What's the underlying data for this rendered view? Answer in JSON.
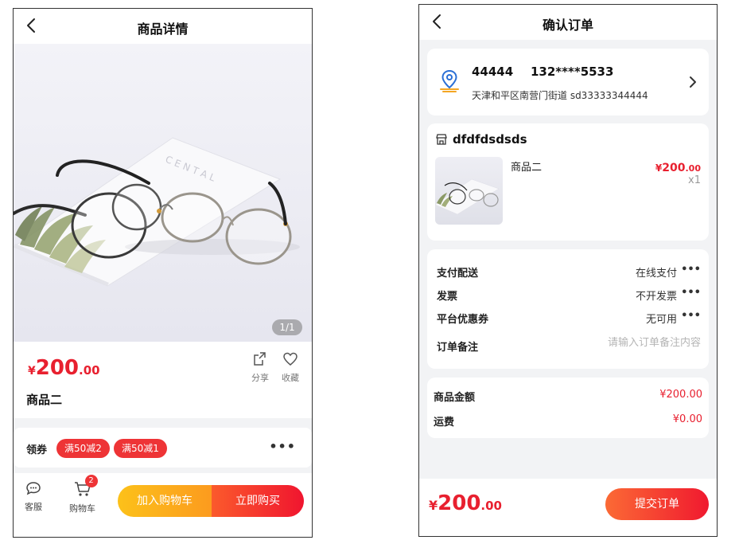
{
  "product_page": {
    "title": "商品详情",
    "image_counter": "1/1",
    "price": {
      "currency": "¥",
      "integer": "200",
      "decimal": ".00"
    },
    "product_name": "商品二",
    "share_label": "分享",
    "favorite_label": "收藏",
    "coupons": {
      "label": "领券",
      "tags": [
        "满50减2",
        "满50减1"
      ]
    },
    "bottom_bar": {
      "service_label": "客服",
      "cart_label": "购物车",
      "cart_badge": "2",
      "add_to_cart_label": "加入购物车",
      "buy_now_label": "立即购买"
    },
    "icons": {
      "back": "chevron-left-icon",
      "share": "share-icon",
      "favorite": "heart-icon",
      "service": "chat-icon",
      "cart": "cart-icon",
      "more": "more-dots-icon"
    }
  },
  "order_page": {
    "title": "确认订单",
    "address": {
      "name": "44444",
      "phone": "132****5533",
      "detail": "天津和平区南营门街道 sd33333344444"
    },
    "shop": {
      "name": "dfdfdsdsds",
      "item": {
        "name": "商品二",
        "price_currency": "¥",
        "price_integer": "200",
        "price_decimal": ".00",
        "quantity": "x1"
      }
    },
    "options": {
      "payment_label": "支付配送",
      "payment_value": "在线支付",
      "invoice_label": "发票",
      "invoice_value": "不开发票",
      "coupon_label": "平台优惠券",
      "coupon_value": "无可用",
      "note_label": "订单备注",
      "note_placeholder": "请输入订单备注内容",
      "note_value": ""
    },
    "summary": {
      "amount_label": "商品金额",
      "amount_value": "¥200.00",
      "shipping_label": "运费",
      "shipping_value": "¥0.00"
    },
    "total": {
      "currency": "¥",
      "integer": "200",
      "decimal": ".00"
    },
    "submit_label": "提交订单",
    "icons": {
      "location": "location-pin-icon",
      "store": "store-icon",
      "chevron": "chevron-right-icon",
      "back": "chevron-left-icon"
    }
  },
  "colors": {
    "accent_red": "#e8202f",
    "coupon_red": "#ee3436",
    "cart_button_start": "#fcc11a",
    "cart_button_end": "#fc9b1e",
    "buy_button_start": "#fb5a2c",
    "buy_button_end": "#f0152f",
    "background_gray": "#f2f3f5",
    "location_blue": "#2a6fd6",
    "location_orange": "#f4a623"
  }
}
